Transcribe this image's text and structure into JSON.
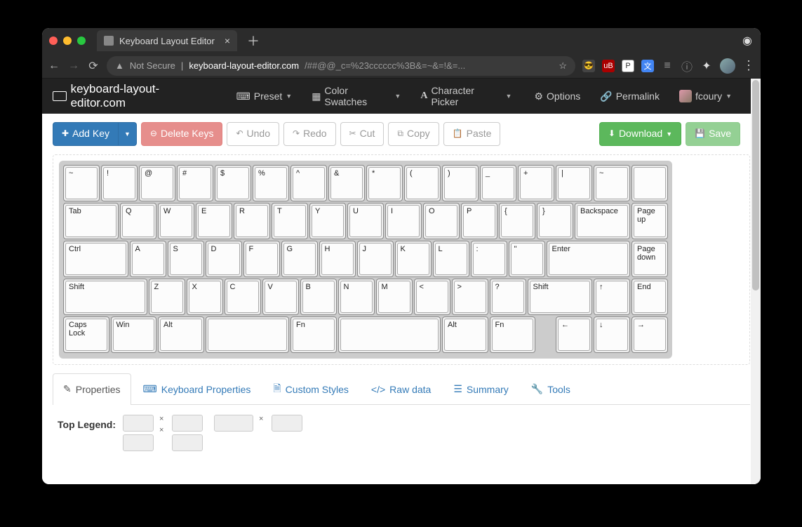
{
  "browser": {
    "tab_title": "Keyboard Layout Editor",
    "not_secure": "Not Secure",
    "host": "keyboard-layout-editor.com",
    "path": "/##@@_c=%23cccccc%3B&=~&=!&=...",
    "star": "☆"
  },
  "navbar": {
    "brand": "keyboard-layout-editor.com",
    "preset": "Preset",
    "swatches": "Color Swatches",
    "charpicker": "Character Picker",
    "options": "Options",
    "permalink": "Permalink",
    "user": "fcoury"
  },
  "toolbar": {
    "add_key": "Add Key",
    "delete_keys": "Delete Keys",
    "undo": "Undo",
    "redo": "Redo",
    "cut": "Cut",
    "copy": "Copy",
    "paste": "Paste",
    "download": "Download",
    "save": "Save"
  },
  "tabs": {
    "properties": "Properties",
    "kbdprops": "Keyboard Properties",
    "styles": "Custom Styles",
    "raw": "Raw data",
    "summary": "Summary",
    "tools": "Tools"
  },
  "props": {
    "top_legend": "Top Legend:"
  },
  "keyboard": {
    "unit": 54,
    "rows": [
      [
        {
          "label": "~",
          "w": 1
        },
        {
          "label": "!",
          "w": 1
        },
        {
          "label": "@",
          "w": 1
        },
        {
          "label": "#",
          "w": 1
        },
        {
          "label": "$",
          "w": 1
        },
        {
          "label": "%",
          "w": 1
        },
        {
          "label": "^",
          "w": 1
        },
        {
          "label": "&",
          "w": 1
        },
        {
          "label": "*",
          "w": 1
        },
        {
          "label": "(",
          "w": 1
        },
        {
          "label": ")",
          "w": 1
        },
        {
          "label": "_",
          "w": 1
        },
        {
          "label": "+",
          "w": 1
        },
        {
          "label": "|",
          "w": 1
        },
        {
          "label": "~",
          "w": 1
        },
        {
          "label": "",
          "w": 1
        }
      ],
      [
        {
          "label": "Tab",
          "w": 1.5
        },
        {
          "label": "Q",
          "w": 1
        },
        {
          "label": "W",
          "w": 1
        },
        {
          "label": "E",
          "w": 1
        },
        {
          "label": "R",
          "w": 1
        },
        {
          "label": "T",
          "w": 1
        },
        {
          "label": "Y",
          "w": 1
        },
        {
          "label": "U",
          "w": 1
        },
        {
          "label": "I",
          "w": 1
        },
        {
          "label": "O",
          "w": 1
        },
        {
          "label": "P",
          "w": 1
        },
        {
          "label": "{",
          "w": 1
        },
        {
          "label": "}",
          "w": 1
        },
        {
          "label": "Backspace",
          "w": 1.5
        },
        {
          "label": "Page up",
          "w": 1
        }
      ],
      [
        {
          "label": "Ctrl",
          "w": 1.75
        },
        {
          "label": "A",
          "w": 1
        },
        {
          "label": "S",
          "w": 1
        },
        {
          "label": "D",
          "w": 1
        },
        {
          "label": "F",
          "w": 1
        },
        {
          "label": "G",
          "w": 1
        },
        {
          "label": "H",
          "w": 1
        },
        {
          "label": "J",
          "w": 1
        },
        {
          "label": "K",
          "w": 1
        },
        {
          "label": "L",
          "w": 1
        },
        {
          "label": ":",
          "w": 1
        },
        {
          "label": "\"",
          "w": 1
        },
        {
          "label": "Enter",
          "w": 2.25
        },
        {
          "label": "Page down",
          "w": 1
        }
      ],
      [
        {
          "label": "Shift",
          "w": 2.25
        },
        {
          "label": "Z",
          "w": 1
        },
        {
          "label": "X",
          "w": 1
        },
        {
          "label": "C",
          "w": 1
        },
        {
          "label": "V",
          "w": 1
        },
        {
          "label": "B",
          "w": 1
        },
        {
          "label": "N",
          "w": 1
        },
        {
          "label": "M",
          "w": 1
        },
        {
          "label": "<",
          "w": 1
        },
        {
          "label": ">",
          "w": 1
        },
        {
          "label": "?",
          "w": 1
        },
        {
          "label": "Shift",
          "w": 1.75
        },
        {
          "label": "↑",
          "w": 1
        },
        {
          "label": "End",
          "w": 1
        }
      ],
      [
        {
          "label": "Caps Lock",
          "w": 1.25
        },
        {
          "label": "Win",
          "w": 1.25
        },
        {
          "label": "Alt",
          "w": 1.25
        },
        {
          "label": "",
          "w": 2.25
        },
        {
          "label": "Fn",
          "w": 1.25
        },
        {
          "label": "",
          "w": 2.75
        },
        {
          "label": "Alt",
          "w": 1.25
        },
        {
          "label": "Fn",
          "w": 1.25
        },
        {
          "label": "",
          "w": 0.5,
          "gap": true
        },
        {
          "label": "←",
          "w": 1
        },
        {
          "label": "↓",
          "w": 1
        },
        {
          "label": "→",
          "w": 1
        }
      ]
    ]
  }
}
